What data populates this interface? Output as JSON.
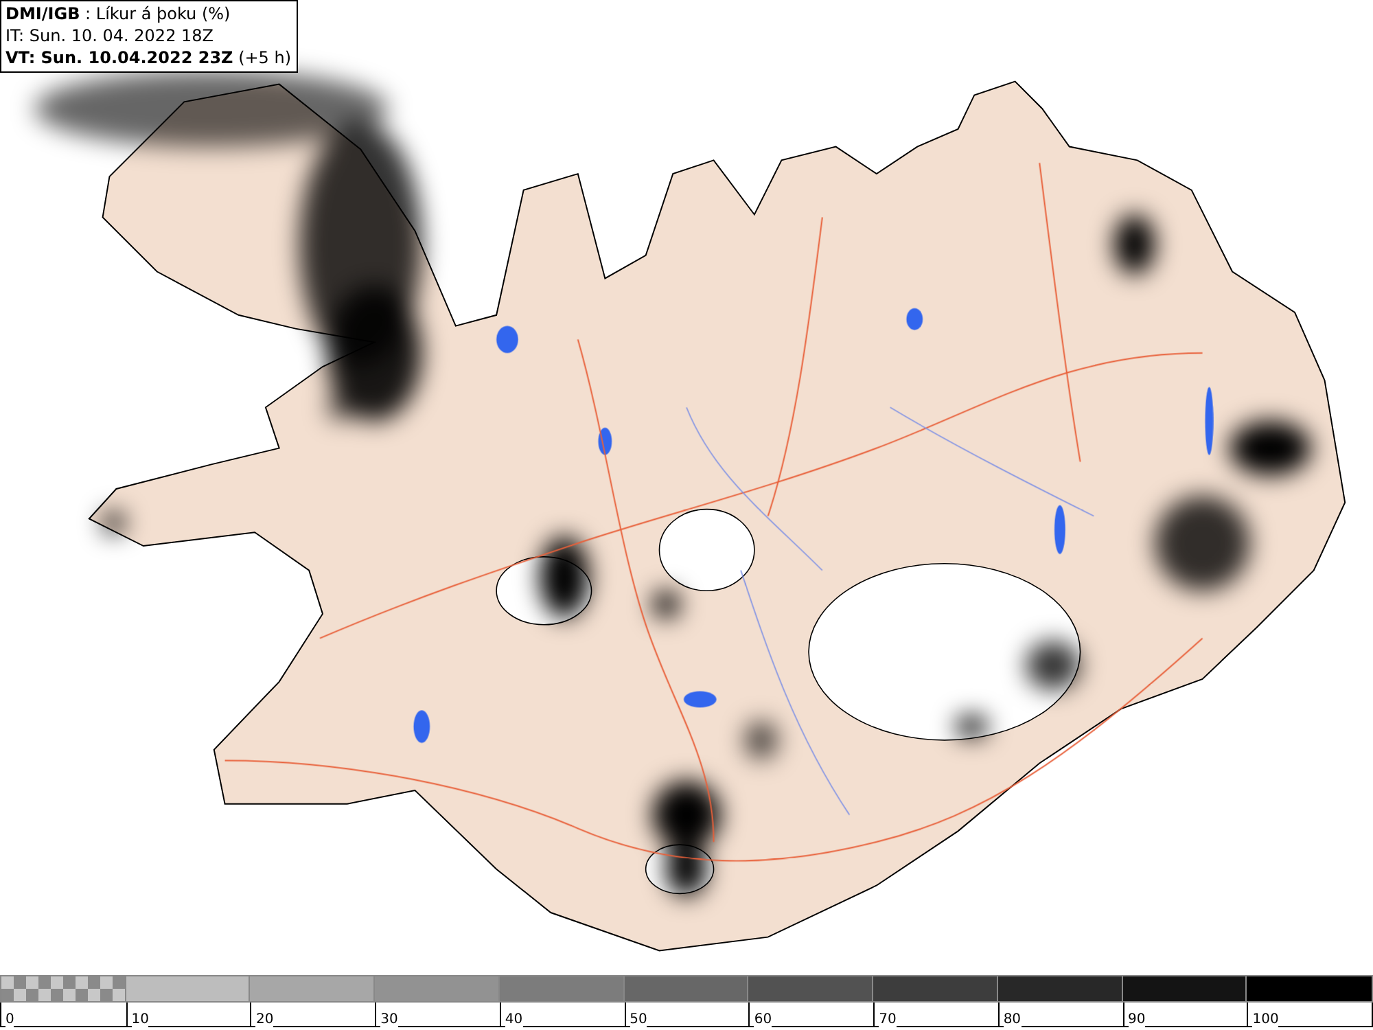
{
  "info": {
    "lines": [
      "**DMI/IGB** : Líkur á þoku (%)",
      "IT: Sun. 10. 04. 2022 18Z",
      "**VT: Sun. 10.04.2022 23Z** (+5 h)"
    ]
  },
  "legend": {
    "bins": [
      {
        "kind": "checker",
        "color": "#8a8a8a"
      },
      {
        "kind": "solid",
        "color": "#bdbdbd"
      },
      {
        "kind": "solid",
        "color": "#a7a7a7"
      },
      {
        "kind": "solid",
        "color": "#929292"
      },
      {
        "kind": "solid",
        "color": "#7c7c7c"
      },
      {
        "kind": "solid",
        "color": "#676767"
      },
      {
        "kind": "solid",
        "color": "#525252"
      },
      {
        "kind": "solid",
        "color": "#3d3d3d"
      },
      {
        "kind": "solid",
        "color": "#282828"
      },
      {
        "kind": "solid",
        "color": "#141414"
      },
      {
        "kind": "solid",
        "color": "#000000"
      }
    ],
    "ticks": [
      "0",
      "10",
      "20",
      "30",
      "40",
      "50",
      "60",
      "70",
      "80",
      "90",
      "100"
    ]
  }
}
